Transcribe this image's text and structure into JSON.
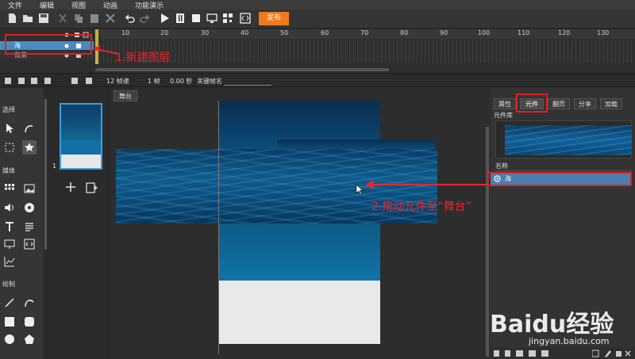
{
  "menu": [
    "文件",
    "编辑",
    "视图",
    "动画",
    "功能演示"
  ],
  "toolbar": {
    "publish_label": "发布"
  },
  "timeline": {
    "ruler_ticks": [
      "10",
      "20",
      "30",
      "40",
      "50",
      "60",
      "70",
      "80",
      "90",
      "100",
      "110",
      "120",
      "130"
    ],
    "layers": [
      {
        "name": "海",
        "selected": true
      },
      {
        "name": "背景",
        "selected": false
      }
    ]
  },
  "status": {
    "fps": "12 帧速",
    "frame": "1 帧",
    "time": "0.00 秒",
    "keyframe_name_label": "关键帧名"
  },
  "left_panel": {
    "section_select": "选择",
    "section_media": "媒体",
    "section_draw": "绘制"
  },
  "thumbnails": {
    "index": "1"
  },
  "stage": {
    "tab_label": "舞台"
  },
  "right_panel": {
    "tabs": [
      "属性",
      "元件",
      "翻页",
      "分享",
      "加载"
    ],
    "active_tab": "元件",
    "library_title": "元件库",
    "name_header": "名称",
    "symbol_name": "海"
  },
  "annotations": {
    "step1": "1.新建图层",
    "step2": "2.拖动元件至“舞台”"
  },
  "colors": {
    "annotation": "#e8262c",
    "publish": "#f07a1a",
    "selection": "#4a8ac2"
  },
  "watermark": {
    "logo": "Baidu经验",
    "url": "jingyan.baidu.com"
  }
}
